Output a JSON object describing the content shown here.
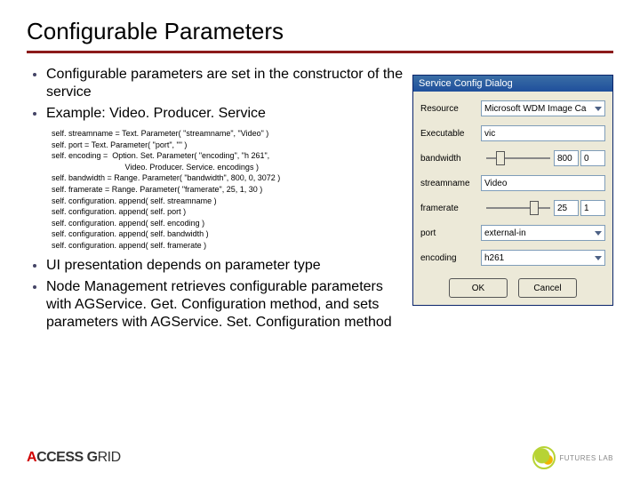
{
  "title": "Configurable Parameters",
  "bullets": {
    "b1": "Configurable parameters are set in the constructor of the service",
    "b2": "Example: Video. Producer. Service",
    "b3": "UI presentation depends on parameter type",
    "b4": "Node Management retrieves configurable parameters with AGService. Get. Configuration method, and sets parameters with AGService. Set. Configuration method"
  },
  "code": {
    "l1": "self. streamname = Text. Parameter( \"streamname\", \"Video\" )",
    "l2": "self. port = Text. Parameter( \"port\", \"\" )",
    "l3": "self. encoding =  Option. Set. Parameter( \"encoding\", \"h 261\",",
    "l4": "                                 Video. Producer. Service. encodings )",
    "l5": "self. bandwidth = Range. Parameter( \"bandwidth\", 800, 0, 3072 )",
    "l6": "self. framerate = Range. Parameter( \"framerate\", 25, 1, 30 )",
    "l7": "self. configuration. append( self. streamname )",
    "l8": "self. configuration. append( self. port )",
    "l9": "self. configuration. append( self. encoding )",
    "l10": "self. configuration. append( self. bandwidth )",
    "l11": "self. configuration. append( self. framerate )"
  },
  "dialog": {
    "title": "Service Config Dialog",
    "rows": {
      "resource": {
        "label": "Resource",
        "value": "Microsoft WDM Image Ca"
      },
      "executable": {
        "label": "Executable",
        "value": "vic"
      },
      "bandwidth": {
        "label": "bandwidth",
        "value": "800",
        "readout": "0"
      },
      "streamname": {
        "label": "streamname",
        "value": "Video"
      },
      "framerate": {
        "label": "framerate",
        "value": "25",
        "readout": "1"
      },
      "port": {
        "label": "port",
        "value": "external-in"
      },
      "encoding": {
        "label": "encoding",
        "value": "h261"
      }
    },
    "ok": "OK",
    "cancel": "Cancel"
  },
  "footer": {
    "ag_a": "A",
    "ag_rest": "CCESS G",
    "ag_rid": "RID",
    "fl": "FUTURES LAB"
  }
}
